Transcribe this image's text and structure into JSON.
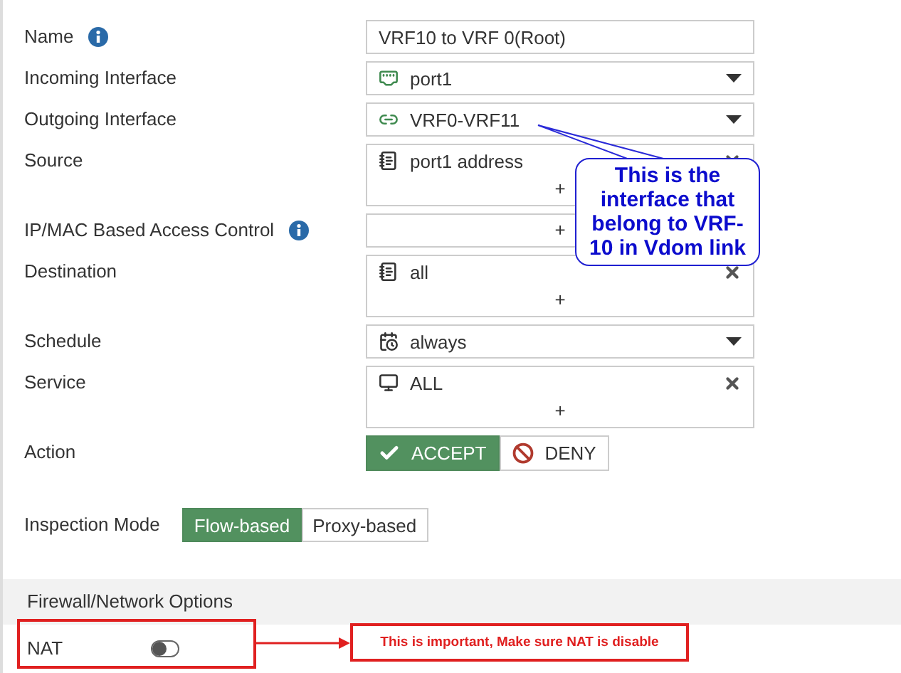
{
  "fields": [
    {
      "label": "Name",
      "info": true,
      "kind": "text",
      "value": "VRF10 to VRF 0(Root)"
    },
    {
      "label": "Incoming Interface",
      "info": false,
      "kind": "select",
      "value": "port1"
    },
    {
      "label": "Outgoing Interface",
      "info": false,
      "kind": "select",
      "value": "VRF0-VRF11"
    },
    {
      "label": "Source",
      "info": false,
      "kind": "multi",
      "value": "port1 address",
      "add": "+"
    },
    {
      "label": "IP/MAC Based Access Control",
      "info": true,
      "kind": "add-only",
      "add": "+"
    },
    {
      "label": "Destination",
      "info": false,
      "kind": "multi",
      "value": "all",
      "add": "+"
    },
    {
      "label": "Schedule",
      "info": false,
      "kind": "select",
      "value": "always"
    },
    {
      "label": "Service",
      "info": false,
      "kind": "multi",
      "value": "ALL",
      "add": "+"
    }
  ],
  "action": {
    "label": "Action",
    "options": [
      {
        "label": "ACCEPT",
        "selected": true
      },
      {
        "label": "DENY",
        "selected": false
      }
    ]
  },
  "inspection_mode": {
    "label": "Inspection Mode",
    "options": [
      {
        "label": "Flow-based",
        "selected": true
      },
      {
        "label": "Proxy-based",
        "selected": false
      }
    ]
  },
  "section": {
    "title": "Firewall/Network Options"
  },
  "nat": {
    "label": "NAT",
    "on": false
  },
  "callouts": [
    {
      "text": "This is the interface that belong to VRF-10 in Vdom link"
    },
    {
      "text": "This is important, Make sure NAT is disable"
    }
  ]
}
